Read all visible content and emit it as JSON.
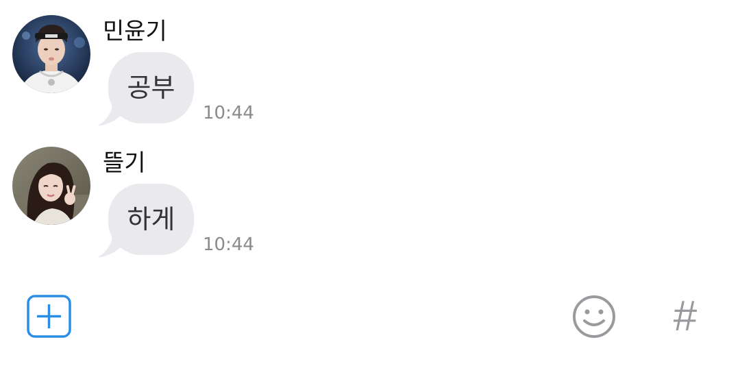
{
  "messages": [
    {
      "sender": "민윤기",
      "text": "공부",
      "time": "10:44",
      "avatar": "person-with-headband-avatar"
    },
    {
      "sender": "뜰기",
      "text": "하게",
      "time": "10:44",
      "avatar": "person-peace-sign-avatar"
    }
  ],
  "toolbar": {
    "add_icon": "plus-square-icon",
    "emoji_icon": "smiley-face-icon",
    "hashtag_label": "#"
  },
  "colors": {
    "bubble": "#e9e9ee",
    "accent_blue": "#2b8ee6",
    "icon_gray": "#9a9a9e",
    "timestamp": "#8a8a8e"
  }
}
